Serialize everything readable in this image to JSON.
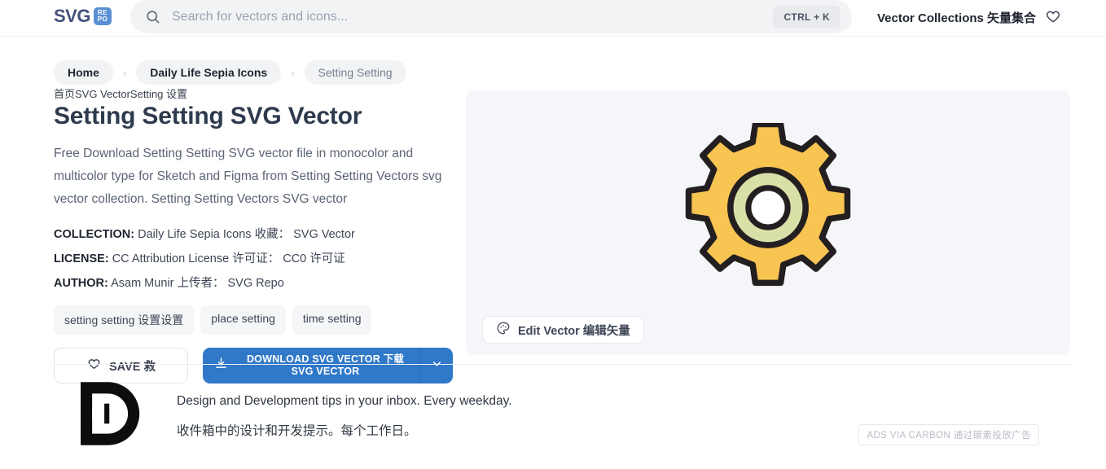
{
  "header": {
    "logo": {
      "text": "SVG",
      "badge_line1": "RE",
      "badge_line2": "PO",
      "badge_color": "#5b8fd4",
      "text_color": "#41517a"
    },
    "search": {
      "placeholder": "Search for vectors and icons...",
      "value": "",
      "shortcut": "CTRL + K",
      "icon": "search-icon"
    },
    "nav_link": "Vector Collections 矢量集合",
    "favorites_icon": "heart-icon"
  },
  "breadcrumb": {
    "separator": "›",
    "items": [
      {
        "label": "Home",
        "muted": false
      },
      {
        "label": "Daily Life Sepia Icons",
        "muted": false
      },
      {
        "label": "Setting Setting",
        "muted": true
      }
    ]
  },
  "main": {
    "subtitle_zh": "首页SVG VectorSetting 设置",
    "title": "Setting Setting SVG Vector",
    "description": "Free Download Setting Setting SVG vector file in monocolor and multicolor type for Sketch and Figma from Setting Setting Vectors svg vector collection. Setting Setting Vectors SVG vector",
    "meta": [
      {
        "label": "COLLECTION:",
        "value": "Daily Life Sepia Icons 收藏： SVG Vector"
      },
      {
        "label": "LICENSE:",
        "value": "CC Attribution License 许可证： CC0 许可证"
      },
      {
        "label": "AUTHOR:",
        "value": "Asam Munir 上传者： SVG Repo"
      }
    ],
    "tags": [
      "setting setting 设置设置",
      "place setting",
      "time setting"
    ],
    "buttons": {
      "save": {
        "label": "SAVE 救",
        "icon": "heart-icon"
      },
      "download": {
        "label": "DOWNLOAD SVG VECTOR 下载 SVG VECTOR",
        "icon": "download-icon",
        "caret_icon": "chevron-down-icon",
        "color": "#3078c8"
      },
      "edit": {
        "label": "Edit Vector 编辑矢量",
        "icon": "palette-icon"
      }
    }
  },
  "preview": {
    "background": "#f5f6fa",
    "artwork": {
      "name": "gear-icon",
      "teeth": 8,
      "body_color": "#f8c452",
      "stroke_color": "#231f20",
      "ring_color": "#d8e0a8",
      "hole_color": "#ffffff"
    }
  },
  "ad": {
    "logo_name": "design-and-development-logo",
    "line_en": "Design and Development tips in your inbox. Every weekday.",
    "line_zh": "收件箱中的设计和开发提示。每个工作日。",
    "badge": "ADS VIA CARBON 通过碳素投放广告"
  }
}
